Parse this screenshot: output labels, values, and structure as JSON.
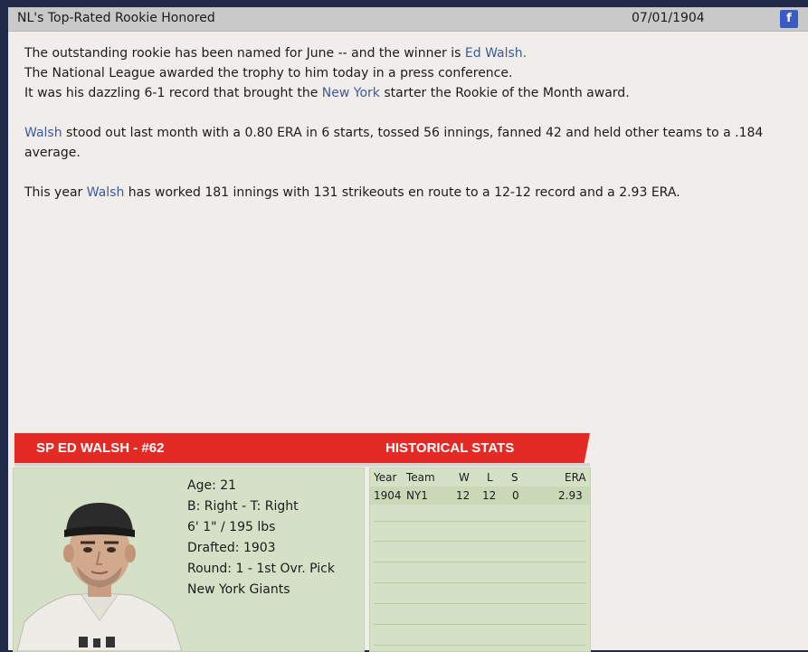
{
  "header": {
    "title": "NL's Top-Rated Rookie Honored",
    "date": "07/01/1904",
    "share_icon": "facebook-icon",
    "share_glyph": "f"
  },
  "article": {
    "p1": {
      "a": "The outstanding rookie has been named for June -- and the winner is ",
      "link_player": "Ed Walsh.",
      "b": "The National League awarded the trophy to him today in a press conference.",
      "c": "It was his dazzling 6-1 record that brought the ",
      "link_team": "New York",
      "d": " starter the Rookie of the Month award."
    },
    "p2": {
      "link_player": "Walsh",
      "a": " stood out last month with a 0.80 ERA in 6 starts, tossed 56 innings, fanned 42 and held other teams to a .184 average."
    },
    "p3": {
      "a": "This year ",
      "link_player": "Walsh",
      "b": " has worked 181 innings with 131 strikeouts en route to a 12-12 record and a 2.93 ERA."
    }
  },
  "card": {
    "title": "SP ED WALSH - #62",
    "stats_title": "HISTORICAL STATS",
    "age": "Age: 21",
    "bats_throws": "B: Right - T: Right",
    "height_weight": "6' 1\" / 195 lbs",
    "drafted": "Drafted: 1903",
    "round": "Round: 1 - 1st Ovr. Pick",
    "team": "New York Giants"
  },
  "stats": {
    "headers": [
      "Year",
      "Team",
      "W",
      "L",
      "S",
      "ERA"
    ],
    "rows": [
      [
        "1904",
        "NY1",
        "12",
        "12",
        "0",
        "2.93"
      ]
    ]
  },
  "colors": {
    "background": "#1e2a47",
    "panel": "#f1edeb",
    "header_bar": "#c9c9c9",
    "link": "#3a5a9c",
    "card_red": "#e42a25",
    "card_green": "#d5e1c6"
  }
}
